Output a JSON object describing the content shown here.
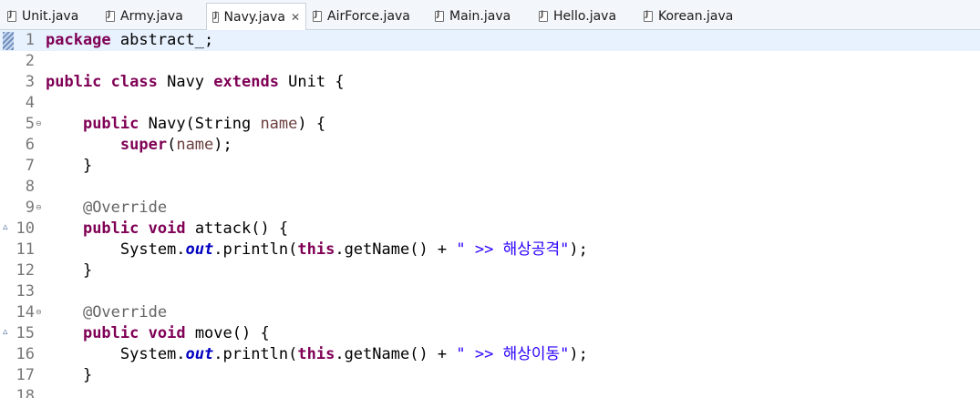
{
  "tabs": [
    {
      "label": "Unit.java",
      "active": false
    },
    {
      "label": "Army.java",
      "active": false
    },
    {
      "label": "Navy.java",
      "active": true
    },
    {
      "label": "AirForce.java",
      "active": false
    },
    {
      "label": "Main.java",
      "active": false
    },
    {
      "label": "Hello.java",
      "active": false
    },
    {
      "label": "Korean.java",
      "active": false
    }
  ],
  "close_glyph": "✕",
  "lines": [
    {
      "n": "1",
      "t": [
        [
          "kw",
          "package"
        ],
        [
          "p",
          " abstract_;"
        ]
      ]
    },
    {
      "n": "2",
      "t": []
    },
    {
      "n": "3",
      "t": [
        [
          "kw",
          "public"
        ],
        [
          "p",
          " "
        ],
        [
          "kw",
          "class"
        ],
        [
          "p",
          " Navy "
        ],
        [
          "kw",
          "extends"
        ],
        [
          "p",
          " Unit {"
        ]
      ]
    },
    {
      "n": "4",
      "t": []
    },
    {
      "n": "5",
      "t": [
        [
          "p",
          "    "
        ],
        [
          "kw",
          "public"
        ],
        [
          "p",
          " Navy(String "
        ],
        [
          "param",
          "name"
        ],
        [
          "p",
          ") {"
        ]
      ]
    },
    {
      "n": "6",
      "t": [
        [
          "p",
          "        "
        ],
        [
          "kw",
          "super"
        ],
        [
          "p",
          "("
        ],
        [
          "param",
          "name"
        ],
        [
          "p",
          ");"
        ]
      ]
    },
    {
      "n": "7",
      "t": [
        [
          "p",
          "    }"
        ]
      ]
    },
    {
      "n": "8",
      "t": []
    },
    {
      "n": "9",
      "t": [
        [
          "p",
          "    "
        ],
        [
          "ann",
          "@Override"
        ]
      ]
    },
    {
      "n": "10",
      "t": [
        [
          "p",
          "    "
        ],
        [
          "kw",
          "public"
        ],
        [
          "p",
          " "
        ],
        [
          "kw",
          "void"
        ],
        [
          "p",
          " attack() {"
        ]
      ]
    },
    {
      "n": "11",
      "t": [
        [
          "p",
          "        System."
        ],
        [
          "fld",
          "out"
        ],
        [
          "p",
          ".println("
        ],
        [
          "kw",
          "this"
        ],
        [
          "p",
          ".getName() + "
        ],
        [
          "str",
          "\" >> 해상공격\""
        ],
        [
          "p",
          ");"
        ]
      ]
    },
    {
      "n": "12",
      "t": [
        [
          "p",
          "    }"
        ]
      ]
    },
    {
      "n": "13",
      "t": []
    },
    {
      "n": "14",
      "t": [
        [
          "p",
          "    "
        ],
        [
          "ann",
          "@Override"
        ]
      ]
    },
    {
      "n": "15",
      "t": [
        [
          "p",
          "    "
        ],
        [
          "kw",
          "public"
        ],
        [
          "p",
          " "
        ],
        [
          "kw",
          "void"
        ],
        [
          "p",
          " move() {"
        ]
      ]
    },
    {
      "n": "16",
      "t": [
        [
          "p",
          "        System."
        ],
        [
          "fld",
          "out"
        ],
        [
          "p",
          ".println("
        ],
        [
          "kw",
          "this"
        ],
        [
          "p",
          ".getName() + "
        ],
        [
          "str",
          "\" >> 해상이동\""
        ],
        [
          "p",
          ");"
        ]
      ]
    },
    {
      "n": "17",
      "t": [
        [
          "p",
          "    }"
        ]
      ]
    },
    {
      "n": "18",
      "t": []
    }
  ]
}
